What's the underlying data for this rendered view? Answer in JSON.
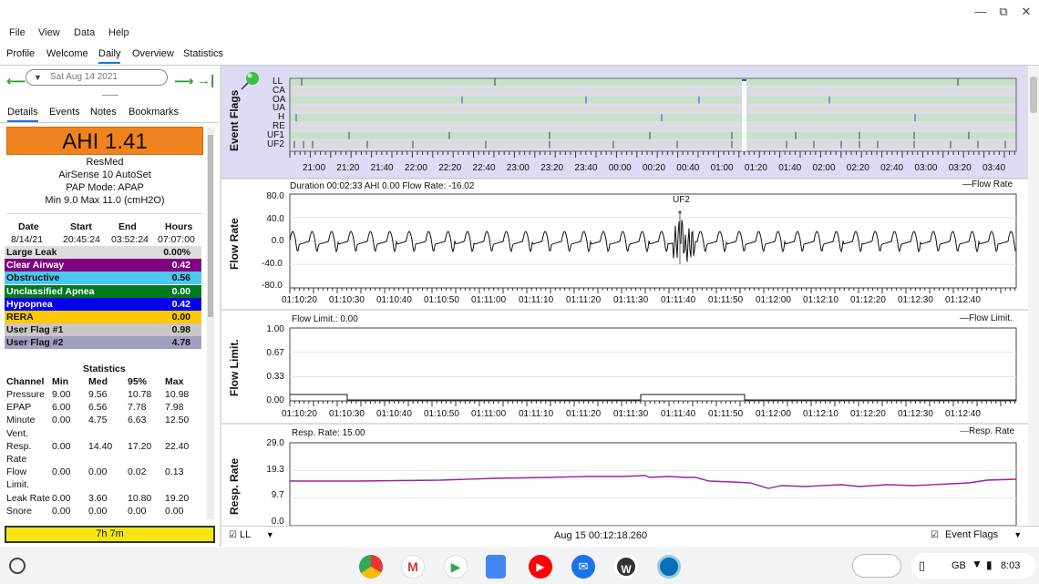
{
  "menu": [
    "File",
    "View",
    "Data",
    "Help"
  ],
  "tabs": [
    "Profile",
    "Welcome",
    "Daily",
    "Overview",
    "Statistics"
  ],
  "active_tab": "Daily",
  "date": "Sat Aug 14 2021",
  "subtabs": [
    "Details",
    "Events",
    "Notes",
    "Bookmarks"
  ],
  "ahi": "AHI 1.41",
  "device": {
    "brand": "ResMed",
    "model": "AirSense 10 AutoSet",
    "mode": "PAP Mode: APAP",
    "pressure": "Min 9.0 Max 11.0 (cmH2O)"
  },
  "session": {
    "headers": [
      "Date",
      "Start",
      "End",
      "Hours"
    ],
    "values": [
      "8/14/21",
      "20:45:24",
      "03:52:24",
      "07:07:00"
    ]
  },
  "events": [
    {
      "name": "Large Leak",
      "value": "0.00%",
      "color": "#dddddd",
      "text": "#111111"
    },
    {
      "name": "Clear Airway",
      "value": "0.42",
      "color": "#800080",
      "text": "#ffffff"
    },
    {
      "name": "Obstructive",
      "value": "0.56",
      "color": "#4ac8f0",
      "text": "#111111"
    },
    {
      "name": "Unclassified Apnea",
      "value": "0.00",
      "color": "#007a1f",
      "text": "#ffffff"
    },
    {
      "name": "Hypopnea",
      "value": "0.42",
      "color": "#0000ee",
      "text": "#ffffff"
    },
    {
      "name": "RERA",
      "value": "0.00",
      "color": "#ffc800",
      "text": "#111111"
    },
    {
      "name": "User Flag #1",
      "value": "0.98",
      "color": "#c8c8c8",
      "text": "#111111"
    },
    {
      "name": "User Flag #2",
      "value": "4.78",
      "color": "#a0a0c0",
      "text": "#111111"
    }
  ],
  "statistics": {
    "title": "Statistics",
    "headers": [
      "Channel",
      "Min",
      "Med",
      "95%",
      "Max"
    ],
    "rows": [
      [
        "Pressure",
        "9.00",
        "9.56",
        "10.78",
        "10.98"
      ],
      [
        "EPAP",
        "6.00",
        "6.56",
        "7.78",
        "7.98"
      ],
      [
        "Minute",
        "0.00",
        "4.75",
        "6.63",
        "12.50"
      ],
      [
        "Vent.",
        "",
        "",
        "",
        ""
      ],
      [
        "Resp.",
        "0.00",
        "14.40",
        "17.20",
        "22.40"
      ],
      [
        "Rate",
        "",
        "",
        "",
        ""
      ],
      [
        "Flow",
        "0.00",
        "0.00",
        "0.02",
        "0.13"
      ],
      [
        "Limit.",
        "",
        "",
        "",
        ""
      ],
      [
        "Leak Rate",
        "0.00",
        "3.60",
        "10.80",
        "19.20"
      ],
      [
        "Snore",
        "0.00",
        "0.00",
        "0.00",
        "0.00"
      ]
    ]
  },
  "total_time": "7h 7m",
  "event_flags": {
    "label": "Event Flags",
    "rows": [
      "LL",
      "CA",
      "OA",
      "UA",
      "H",
      "RE",
      "UF1",
      "UF2"
    ],
    "times": [
      "21:00",
      "21:20",
      "21:40",
      "22:00",
      "22:20",
      "22:40",
      "23:00",
      "23:20",
      "23:40",
      "00:00",
      "00:20",
      "00:40",
      "01:00",
      "01:20",
      "01:40",
      "02:00",
      "02:20",
      "02:40",
      "03:00",
      "03:20",
      "03:40"
    ]
  },
  "flow_rate": {
    "label": "Flow Rate",
    "header": "Duration 00:02:33 AHI 0.00 Flow Rate: -16.02",
    "legend": "Flow Rate",
    "yticks": [
      "80.0",
      "40.0",
      "0.0",
      "-40.0",
      "-80.0"
    ],
    "marker": "UF2"
  },
  "flow_limit": {
    "label": "Flow Limit.",
    "header": "Flow Limit.: 0.00",
    "legend": "Flow Limit.",
    "yticks": [
      "1.00",
      "0.67",
      "0.33",
      "0.00"
    ]
  },
  "resp_rate": {
    "label": "Resp. Rate",
    "header": "Resp. Rate: 15.00",
    "legend": "Resp. Rate",
    "yticks": [
      "29.0",
      "19.3",
      "9.7",
      "0.0"
    ]
  },
  "time_axis": [
    "01:10:20",
    "01:10:30",
    "01:10:40",
    "01:10:50",
    "01:11:00",
    "01:11:10",
    "01:11:20",
    "01:11:30",
    "01:11:40",
    "01:11:50",
    "01:12:00",
    "01:12:10",
    "01:12:20",
    "01:12:30",
    "01:12:40"
  ],
  "bottom": {
    "left_combo": "LL",
    "center": "Aug 15 00:12:18.260",
    "right_combo": "Event Flags"
  },
  "tray": {
    "lang": "GB",
    "time": "8:03"
  }
}
